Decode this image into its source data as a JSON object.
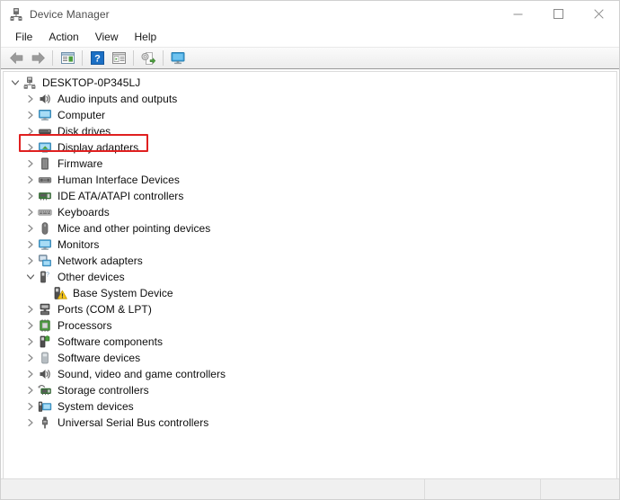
{
  "window": {
    "title": "Device Manager",
    "title_icon": "device-manager-icon",
    "controls": {
      "minimize_label": "—",
      "maximize_label": "☐",
      "close_label": "✕"
    }
  },
  "menubar": {
    "items": [
      {
        "label": "File"
      },
      {
        "label": "Action"
      },
      {
        "label": "View"
      },
      {
        "label": "Help"
      }
    ]
  },
  "toolbar": {
    "buttons": [
      {
        "name": "back-button",
        "icon": "left-arrow-icon"
      },
      {
        "name": "forward-button",
        "icon": "right-arrow-icon"
      },
      {
        "name": "separator-1",
        "icon": "separator"
      },
      {
        "name": "properties-button",
        "icon": "properties-window-icon"
      },
      {
        "name": "separator-2",
        "icon": "separator"
      },
      {
        "name": "help-button",
        "icon": "blue-question-mark-icon"
      },
      {
        "name": "show-details-button",
        "icon": "details-window-icon"
      },
      {
        "name": "separator-3",
        "icon": "separator"
      },
      {
        "name": "scan-hardware-changes-button",
        "icon": "scan-hardware-icon"
      },
      {
        "name": "separator-4",
        "icon": "separator"
      },
      {
        "name": "update-driver-button",
        "icon": "monitor-icon"
      }
    ]
  },
  "tree": {
    "root": {
      "label": "DESKTOP-0P345LJ",
      "icon": "computer-tower-icon",
      "expanded": true,
      "level": 0
    },
    "items": [
      {
        "label": "Audio inputs and outputs",
        "icon": "speaker-icon",
        "expanded": false,
        "level": 1
      },
      {
        "label": "Computer",
        "icon": "monitor-blue-icon",
        "expanded": false,
        "level": 1
      },
      {
        "label": "Disk drives",
        "icon": "disk-drive-icon",
        "expanded": false,
        "level": 1
      },
      {
        "label": "Display adapters",
        "icon": "display-adapter-icon",
        "expanded": false,
        "level": 1,
        "highlighted": true
      },
      {
        "label": "Firmware",
        "icon": "firmware-chip-icon",
        "expanded": false,
        "level": 1
      },
      {
        "label": "Human Interface Devices",
        "icon": "hid-icon",
        "expanded": false,
        "level": 1
      },
      {
        "label": "IDE ATA/ATAPI controllers",
        "icon": "ide-controller-icon",
        "expanded": false,
        "level": 1
      },
      {
        "label": "Keyboards",
        "icon": "keyboard-icon",
        "expanded": false,
        "level": 1
      },
      {
        "label": "Mice and other pointing devices",
        "icon": "mouse-icon",
        "expanded": false,
        "level": 1
      },
      {
        "label": "Monitors",
        "icon": "monitor-blue-icon",
        "expanded": false,
        "level": 1
      },
      {
        "label": "Network adapters",
        "icon": "network-adapter-icon",
        "expanded": false,
        "level": 1
      },
      {
        "label": "Other devices",
        "icon": "other-device-icon",
        "expanded": true,
        "level": 1
      },
      {
        "label": "Base System Device",
        "icon": "unknown-device-warning-icon",
        "expanded": null,
        "level": 2,
        "warning": true
      },
      {
        "label": "Ports (COM & LPT)",
        "icon": "port-icon",
        "expanded": false,
        "level": 1
      },
      {
        "label": "Processors",
        "icon": "processor-icon",
        "expanded": false,
        "level": 1
      },
      {
        "label": "Software components",
        "icon": "software-component-icon",
        "expanded": false,
        "level": 1
      },
      {
        "label": "Software devices",
        "icon": "software-device-icon",
        "expanded": false,
        "level": 1
      },
      {
        "label": "Sound, video and game controllers",
        "icon": "speaker-icon",
        "expanded": false,
        "level": 1
      },
      {
        "label": "Storage controllers",
        "icon": "storage-controller-icon",
        "expanded": false,
        "level": 1
      },
      {
        "label": "System devices",
        "icon": "system-device-icon",
        "expanded": false,
        "level": 1
      },
      {
        "label": "Universal Serial Bus controllers",
        "icon": "usb-icon",
        "expanded": false,
        "level": 1
      }
    ]
  },
  "statusbar": {
    "main": "",
    "segment1": "",
    "segment2": ""
  },
  "colors": {
    "highlight_red": "#e02020",
    "icon_blue": "#3b9fd8",
    "icon_green": "#4d9e3f",
    "icon_gray": "#5a5a5a",
    "warning_yellow": "#f5c518"
  }
}
